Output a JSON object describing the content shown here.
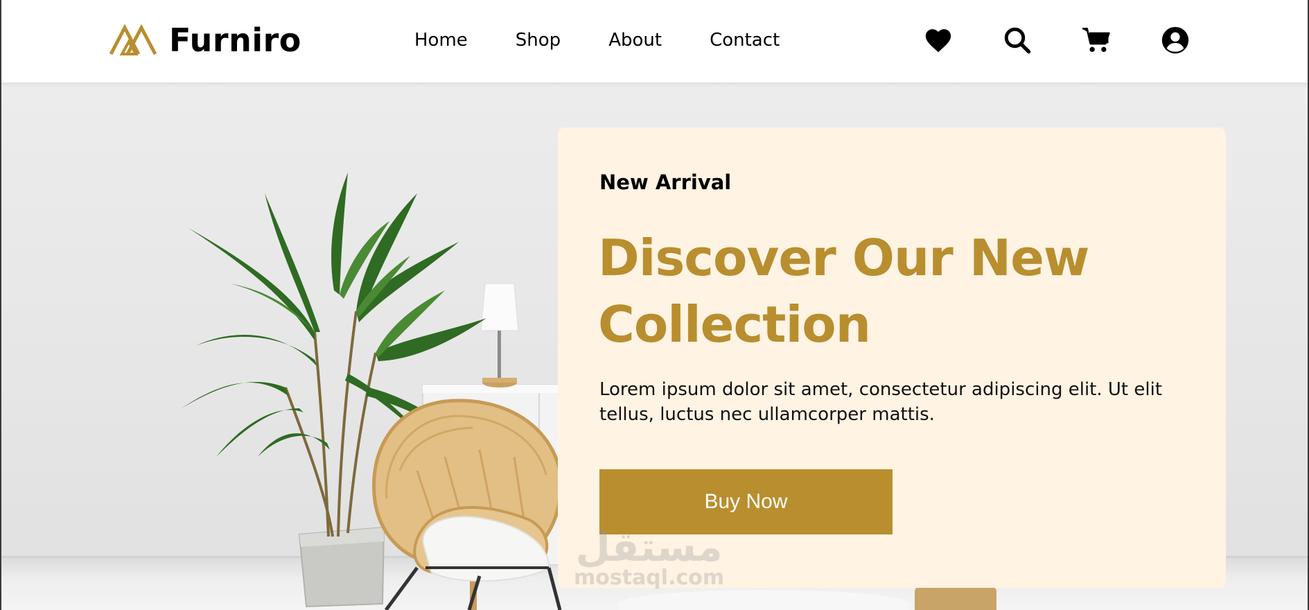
{
  "brand": {
    "name": "Furniro",
    "accent_color": "#b88e2f",
    "logo_icon": "triangle-logo-icon"
  },
  "nav": {
    "items": [
      {
        "label": "Home"
      },
      {
        "label": "Shop"
      },
      {
        "label": "About"
      },
      {
        "label": "Contact"
      }
    ]
  },
  "header_icons": [
    "heart-icon",
    "search-icon",
    "cart-icon",
    "account-icon"
  ],
  "hero": {
    "eyebrow": "New Arrival",
    "headline_line1": "Discover Our New",
    "headline_line2": "Collection",
    "description": "Lorem ipsum dolor sit amet, consectetur adipiscing elit. Ut elit tellus, luctus nec ullamcorper mattis.",
    "cta_label": "Buy Now",
    "card_color": "#fff3e3"
  },
  "watermark": {
    "arabic": "مستقل",
    "latin": "mostaql.com"
  }
}
